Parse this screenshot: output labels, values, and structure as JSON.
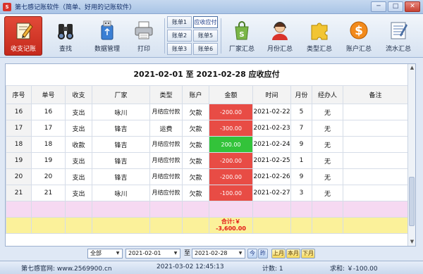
{
  "window": {
    "title": "第七感记账软件（简单、好用的记账软件）",
    "logo_text": "记账"
  },
  "toolbar": {
    "buttons": [
      {
        "label": "收支记账",
        "icon": "pencil-notebook-icon",
        "active": true
      },
      {
        "label": "查找",
        "icon": "binoculars-icon"
      },
      {
        "label": "数据管理",
        "icon": "usb-drive-icon"
      },
      {
        "label": "打印",
        "icon": "printer-icon"
      }
    ],
    "accounts": [
      {
        "label": "账单1"
      },
      {
        "label": "应收应付",
        "selected": true
      },
      {
        "label": "账单2"
      },
      {
        "label": "账单5"
      },
      {
        "label": "账单3"
      },
      {
        "label": "账单6"
      }
    ],
    "reports": [
      {
        "label": "厂家汇总",
        "icon": "shopping-bag-icon"
      },
      {
        "label": "月份汇总",
        "icon": "person-headset-icon"
      },
      {
        "label": "类型汇总",
        "icon": "puzzle-icon"
      },
      {
        "label": "账户汇总",
        "icon": "dollar-coin-icon"
      },
      {
        "label": "流水汇总",
        "icon": "ledger-sheet-icon"
      }
    ]
  },
  "period_title": "2021-02-01  至  2021-02-28 应收应付",
  "table": {
    "columns": [
      "序号",
      "单号",
      "收支",
      "厂家",
      "类型",
      "账户",
      "金额",
      "时间",
      "月份",
      "经办人",
      "备注"
    ],
    "rows": [
      {
        "seq": "16",
        "no": "16",
        "dir": "支出",
        "vendor": "咏川",
        "type": "月结应付款",
        "account": "欠款",
        "amount": "-200.00",
        "sign": "neg",
        "time": "2021-02-22",
        "month": "5",
        "handler": "无",
        "note": ""
      },
      {
        "seq": "17",
        "no": "17",
        "dir": "支出",
        "vendor": "锋吉",
        "type": "运费",
        "account": "欠款",
        "amount": "-300.00",
        "sign": "neg",
        "time": "2021-02-23",
        "month": "7",
        "handler": "无",
        "note": ""
      },
      {
        "seq": "18",
        "no": "18",
        "dir": "收款",
        "vendor": "锋吉",
        "type": "月结应付款",
        "account": "欠款",
        "amount": "200.00",
        "sign": "pos",
        "time": "2021-02-24",
        "month": "9",
        "handler": "无",
        "note": ""
      },
      {
        "seq": "19",
        "no": "19",
        "dir": "支出",
        "vendor": "锋吉",
        "type": "月结应付款",
        "account": "欠款",
        "amount": "-200.00",
        "sign": "neg",
        "time": "2021-02-25",
        "month": "1",
        "handler": "无",
        "note": ""
      },
      {
        "seq": "20",
        "no": "20",
        "dir": "支出",
        "vendor": "锋吉",
        "type": "月结应付款",
        "account": "欠款",
        "amount": "-200.00",
        "sign": "neg",
        "time": "2021-02-26",
        "month": "9",
        "handler": "无",
        "note": ""
      },
      {
        "seq": "21",
        "no": "21",
        "dir": "支出",
        "vendor": "咏川",
        "type": "月结应付款",
        "account": "欠款",
        "amount": "-100.00",
        "sign": "neg",
        "time": "2021-02-27",
        "month": "3",
        "handler": "无",
        "note": ""
      }
    ],
    "total_label": "合计:￥",
    "total_value": "-3,600.00"
  },
  "filter": {
    "category": "全部",
    "start_date": "2021-02-01",
    "to_label": "至",
    "end_date": "2021-02-28",
    "today_btn": "今",
    "yesterday_btn": "昨",
    "prev_month_btn": "上月",
    "this_month_btn": "本月",
    "next_month_btn": "下月"
  },
  "status": {
    "website": "第七感官网: www.2569900.cn",
    "datetime": "2021-03-02 12:45:13",
    "count": "计数: 1",
    "sum": "求和: ￥-100.00"
  },
  "colors": {
    "negative": "#e84c45",
    "positive": "#33c33a",
    "active_button": "#d9332b"
  }
}
